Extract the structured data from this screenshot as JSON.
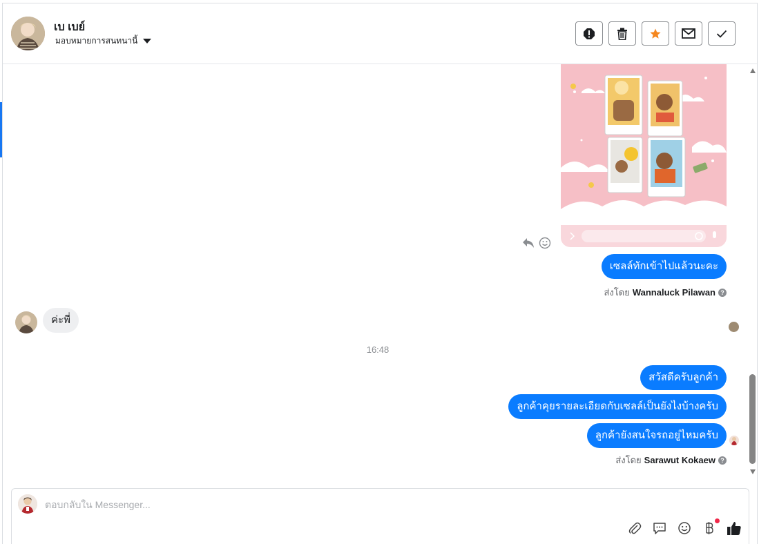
{
  "header": {
    "contact_name": "เบ เบย์",
    "assign_label": "มอบหมายการสนทนานี้"
  },
  "messages": {
    "outgoing_1": "เซลล์ทักเข้าไปแล้วนะคะ",
    "sent_by_label": "ส่งโดย",
    "sender_1": "Wannaluck Pilawan",
    "incoming_1": "ค่ะพี่",
    "timestamp": "16:48",
    "outgoing_2": "สวัสดีครับลูกค้า",
    "outgoing_3": "ลูกค้าคุยรายละเอียดกับเซลล์เป็นยังไงบ้างครับ",
    "outgoing_4": "ลูกค้ายังสนใจรถอยู่ไหมครับ",
    "sender_2": "Sarawut Kokaew"
  },
  "composer": {
    "placeholder": "ตอบกลับใน Messenger..."
  },
  "colors": {
    "accent": "#0a7cff",
    "star": "#f5871f",
    "incoming_bubble": "#eeeff1"
  },
  "icons": [
    "alert-icon",
    "trash-icon",
    "star-icon",
    "envelope-icon",
    "check-icon",
    "reply-icon",
    "emoji-icon",
    "attach-icon",
    "chat-bubble-icon",
    "baht-icon",
    "thumbs-up-icon"
  ]
}
